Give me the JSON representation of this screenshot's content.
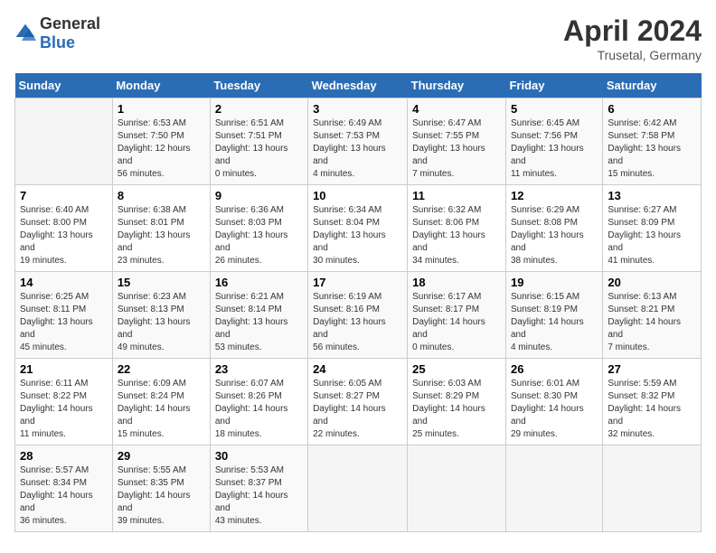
{
  "header": {
    "logo_general": "General",
    "logo_blue": "Blue",
    "month_year": "April 2024",
    "location": "Trusetal, Germany"
  },
  "days_of_week": [
    "Sunday",
    "Monday",
    "Tuesday",
    "Wednesday",
    "Thursday",
    "Friday",
    "Saturday"
  ],
  "weeks": [
    [
      {
        "day": "",
        "sunrise": "",
        "sunset": "",
        "daylight": ""
      },
      {
        "day": "1",
        "sunrise": "Sunrise: 6:53 AM",
        "sunset": "Sunset: 7:50 PM",
        "daylight": "Daylight: 12 hours and 56 minutes."
      },
      {
        "day": "2",
        "sunrise": "Sunrise: 6:51 AM",
        "sunset": "Sunset: 7:51 PM",
        "daylight": "Daylight: 13 hours and 0 minutes."
      },
      {
        "day": "3",
        "sunrise": "Sunrise: 6:49 AM",
        "sunset": "Sunset: 7:53 PM",
        "daylight": "Daylight: 13 hours and 4 minutes."
      },
      {
        "day": "4",
        "sunrise": "Sunrise: 6:47 AM",
        "sunset": "Sunset: 7:55 PM",
        "daylight": "Daylight: 13 hours and 7 minutes."
      },
      {
        "day": "5",
        "sunrise": "Sunrise: 6:45 AM",
        "sunset": "Sunset: 7:56 PM",
        "daylight": "Daylight: 13 hours and 11 minutes."
      },
      {
        "day": "6",
        "sunrise": "Sunrise: 6:42 AM",
        "sunset": "Sunset: 7:58 PM",
        "daylight": "Daylight: 13 hours and 15 minutes."
      }
    ],
    [
      {
        "day": "7",
        "sunrise": "Sunrise: 6:40 AM",
        "sunset": "Sunset: 8:00 PM",
        "daylight": "Daylight: 13 hours and 19 minutes."
      },
      {
        "day": "8",
        "sunrise": "Sunrise: 6:38 AM",
        "sunset": "Sunset: 8:01 PM",
        "daylight": "Daylight: 13 hours and 23 minutes."
      },
      {
        "day": "9",
        "sunrise": "Sunrise: 6:36 AM",
        "sunset": "Sunset: 8:03 PM",
        "daylight": "Daylight: 13 hours and 26 minutes."
      },
      {
        "day": "10",
        "sunrise": "Sunrise: 6:34 AM",
        "sunset": "Sunset: 8:04 PM",
        "daylight": "Daylight: 13 hours and 30 minutes."
      },
      {
        "day": "11",
        "sunrise": "Sunrise: 6:32 AM",
        "sunset": "Sunset: 8:06 PM",
        "daylight": "Daylight: 13 hours and 34 minutes."
      },
      {
        "day": "12",
        "sunrise": "Sunrise: 6:29 AM",
        "sunset": "Sunset: 8:08 PM",
        "daylight": "Daylight: 13 hours and 38 minutes."
      },
      {
        "day": "13",
        "sunrise": "Sunrise: 6:27 AM",
        "sunset": "Sunset: 8:09 PM",
        "daylight": "Daylight: 13 hours and 41 minutes."
      }
    ],
    [
      {
        "day": "14",
        "sunrise": "Sunrise: 6:25 AM",
        "sunset": "Sunset: 8:11 PM",
        "daylight": "Daylight: 13 hours and 45 minutes."
      },
      {
        "day": "15",
        "sunrise": "Sunrise: 6:23 AM",
        "sunset": "Sunset: 8:13 PM",
        "daylight": "Daylight: 13 hours and 49 minutes."
      },
      {
        "day": "16",
        "sunrise": "Sunrise: 6:21 AM",
        "sunset": "Sunset: 8:14 PM",
        "daylight": "Daylight: 13 hours and 53 minutes."
      },
      {
        "day": "17",
        "sunrise": "Sunrise: 6:19 AM",
        "sunset": "Sunset: 8:16 PM",
        "daylight": "Daylight: 13 hours and 56 minutes."
      },
      {
        "day": "18",
        "sunrise": "Sunrise: 6:17 AM",
        "sunset": "Sunset: 8:17 PM",
        "daylight": "Daylight: 14 hours and 0 minutes."
      },
      {
        "day": "19",
        "sunrise": "Sunrise: 6:15 AM",
        "sunset": "Sunset: 8:19 PM",
        "daylight": "Daylight: 14 hours and 4 minutes."
      },
      {
        "day": "20",
        "sunrise": "Sunrise: 6:13 AM",
        "sunset": "Sunset: 8:21 PM",
        "daylight": "Daylight: 14 hours and 7 minutes."
      }
    ],
    [
      {
        "day": "21",
        "sunrise": "Sunrise: 6:11 AM",
        "sunset": "Sunset: 8:22 PM",
        "daylight": "Daylight: 14 hours and 11 minutes."
      },
      {
        "day": "22",
        "sunrise": "Sunrise: 6:09 AM",
        "sunset": "Sunset: 8:24 PM",
        "daylight": "Daylight: 14 hours and 15 minutes."
      },
      {
        "day": "23",
        "sunrise": "Sunrise: 6:07 AM",
        "sunset": "Sunset: 8:26 PM",
        "daylight": "Daylight: 14 hours and 18 minutes."
      },
      {
        "day": "24",
        "sunrise": "Sunrise: 6:05 AM",
        "sunset": "Sunset: 8:27 PM",
        "daylight": "Daylight: 14 hours and 22 minutes."
      },
      {
        "day": "25",
        "sunrise": "Sunrise: 6:03 AM",
        "sunset": "Sunset: 8:29 PM",
        "daylight": "Daylight: 14 hours and 25 minutes."
      },
      {
        "day": "26",
        "sunrise": "Sunrise: 6:01 AM",
        "sunset": "Sunset: 8:30 PM",
        "daylight": "Daylight: 14 hours and 29 minutes."
      },
      {
        "day": "27",
        "sunrise": "Sunrise: 5:59 AM",
        "sunset": "Sunset: 8:32 PM",
        "daylight": "Daylight: 14 hours and 32 minutes."
      }
    ],
    [
      {
        "day": "28",
        "sunrise": "Sunrise: 5:57 AM",
        "sunset": "Sunset: 8:34 PM",
        "daylight": "Daylight: 14 hours and 36 minutes."
      },
      {
        "day": "29",
        "sunrise": "Sunrise: 5:55 AM",
        "sunset": "Sunset: 8:35 PM",
        "daylight": "Daylight: 14 hours and 39 minutes."
      },
      {
        "day": "30",
        "sunrise": "Sunrise: 5:53 AM",
        "sunset": "Sunset: 8:37 PM",
        "daylight": "Daylight: 14 hours and 43 minutes."
      },
      {
        "day": "",
        "sunrise": "",
        "sunset": "",
        "daylight": ""
      },
      {
        "day": "",
        "sunrise": "",
        "sunset": "",
        "daylight": ""
      },
      {
        "day": "",
        "sunrise": "",
        "sunset": "",
        "daylight": ""
      },
      {
        "day": "",
        "sunrise": "",
        "sunset": "",
        "daylight": ""
      }
    ]
  ]
}
